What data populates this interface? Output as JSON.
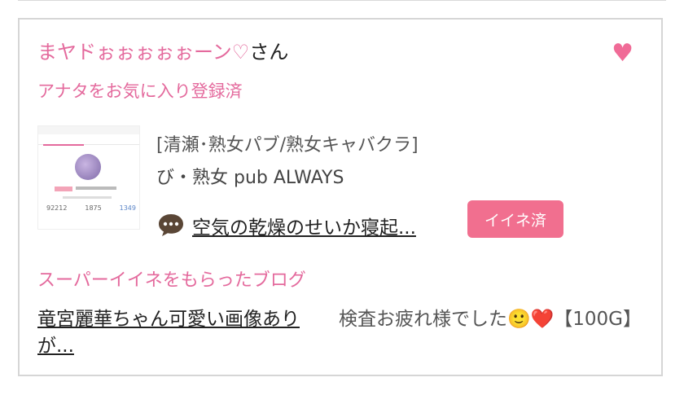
{
  "card": {
    "user_name": "まヤドぉぉぉぉぉーン♡",
    "user_suffix": "さん",
    "favorite_status": "アナタをお気に入り登録済",
    "shop_category": "[清瀬･熟女パブ/熟女キャバクラ]",
    "shop_name": "び・熟女 pub ALWAYS",
    "blog_title": "空気の乾燥のせいか寝起...",
    "iine_button": "イイネ済",
    "super_iine_heading": "スーパーイイネをもらったブログ",
    "super_iine_blog": "竜宮麗華ちゃん可愛い画像ありが...",
    "super_iine_comment": "検査お疲れ様でした🙂❤️【100G】"
  },
  "thumbnail": {
    "stats": [
      "92212",
      "1875",
      "1349"
    ]
  },
  "icons": {
    "favorite": "heart-icon",
    "comment": "speech-bubble-icon"
  },
  "colors": {
    "accent_pink": "#e46a9d",
    "button_pink": "#f16f8f",
    "heart_pink": "#f06b97",
    "comment_icon": "#5a4636",
    "border": "#d6d6d6"
  }
}
